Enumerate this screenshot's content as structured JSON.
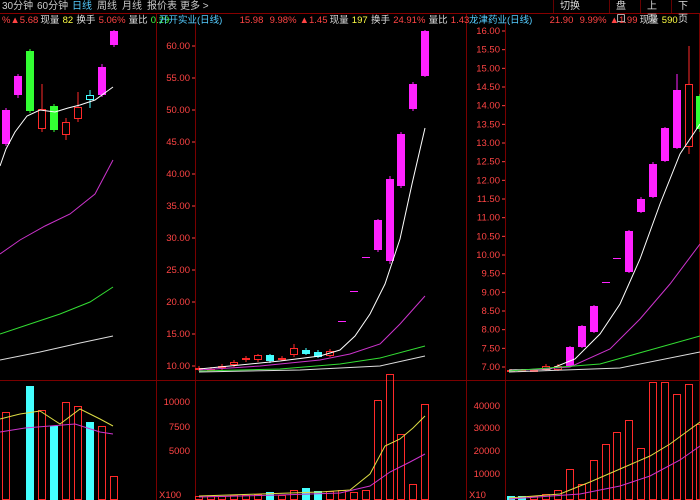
{
  "toolbar": {
    "items": [
      {
        "label": "30分钟",
        "active": false
      },
      {
        "label": "60分钟",
        "active": false
      },
      {
        "label": "日线",
        "active": true
      },
      {
        "label": "周线",
        "active": false
      },
      {
        "label": "月线",
        "active": false
      },
      {
        "label": "报价表",
        "active": false
      },
      {
        "label": "更多 >",
        "active": false
      }
    ],
    "right_buttons": [
      "切换",
      "盘口",
      "上页",
      "下页"
    ]
  },
  "colors": {
    "up": "#ff2a2a",
    "down": "#44ffff",
    "limit_up": "#ff22ff",
    "green_bar": "#33ff33",
    "ma5": "#ffffff",
    "ma10": "#cc33cc",
    "ma20": "#33dd33",
    "grid": "#7a0000",
    "axis_text": "#ff4444",
    "vol_ma1": "#dddd44",
    "vol_ma2": "#cc33cc"
  },
  "charts": [
    {
      "title": "",
      "info": [
        {
          "text": "%",
          "color": "#ff4444"
        },
        {
          "text": "▲5.68",
          "color": "#ff4444"
        },
        {
          "text": "现量",
          "color": "#dddddd"
        },
        {
          "text": "82",
          "color": "#ffff44"
        },
        {
          "text": "换手",
          "color": "#dddddd"
        },
        {
          "text": "5.06%",
          "color": "#ff4444"
        },
        {
          "text": "量比",
          "color": "#dddddd"
        },
        {
          "text": "0.29",
          "color": "#44ff44"
        }
      ],
      "price_ticks": [],
      "vol_ticks": []
    },
    {
      "title": "开开实业(日线)",
      "info": [
        {
          "text": "15.98",
          "color": "#ff4444"
        },
        {
          "text": "9.98%",
          "color": "#ff4444"
        },
        {
          "text": "▲1.45",
          "color": "#ff4444"
        },
        {
          "text": "现量",
          "color": "#dddddd"
        },
        {
          "text": "197",
          "color": "#ffff44"
        },
        {
          "text": "换手",
          "color": "#dddddd"
        },
        {
          "text": "24.91%",
          "color": "#ff4444"
        },
        {
          "text": "量比",
          "color": "#dddddd"
        },
        {
          "text": "1.43",
          "color": "#ff4444"
        }
      ],
      "price_ticks": [
        "60.00",
        "55.00",
        "50.00",
        "45.00",
        "40.00",
        "35.00",
        "30.00",
        "25.00",
        "20.00",
        "15.00",
        "10.00"
      ],
      "vol_ticks": [
        "10000",
        "7500",
        "5000"
      ],
      "vol_unit": "X100"
    },
    {
      "title": "龙津药业(日线)",
      "info": [
        {
          "text": "21.90",
          "color": "#ff4444"
        },
        {
          "text": "9.99%",
          "color": "#ff4444"
        },
        {
          "text": "▲1.99",
          "color": "#ff4444"
        },
        {
          "text": "现量",
          "color": "#dddddd"
        },
        {
          "text": "590",
          "color": "#ffff44"
        }
      ],
      "price_ticks": [
        "16.00",
        "15.50",
        "15.00",
        "14.50",
        "14.00",
        "13.50",
        "13.00",
        "12.50",
        "12.00",
        "11.50",
        "11.00",
        "10.50",
        "10.00",
        "9.50",
        "9.00",
        "8.50",
        "8.00",
        "7.50",
        "7.00"
      ],
      "vol_ticks": [
        "40000",
        "30000",
        "20000",
        "10000"
      ],
      "vol_unit": "X10"
    }
  ]
}
